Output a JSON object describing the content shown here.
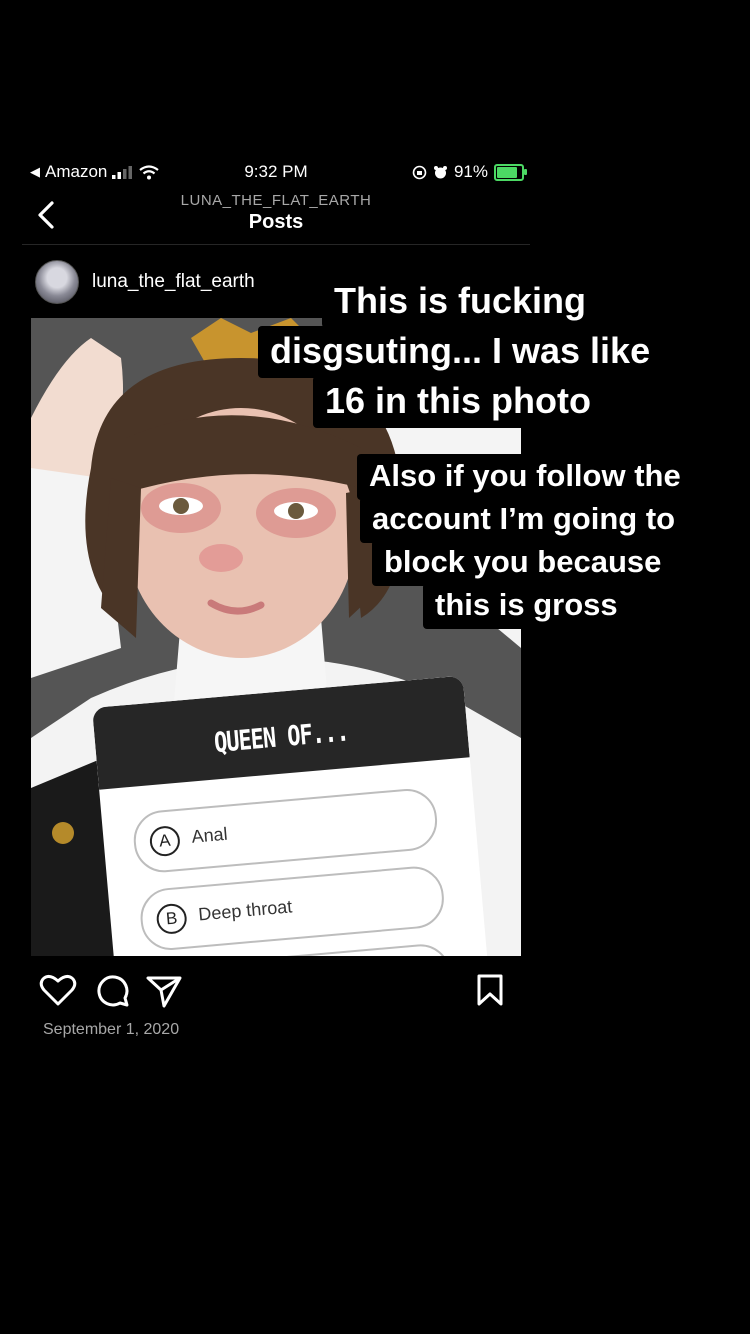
{
  "status_bar": {
    "carrier": "Amazon",
    "time": "9:32 PM",
    "battery": "91%",
    "battery_level": 0.91
  },
  "header": {
    "username": "LUNA_THE_FLAT_EARTH",
    "title": "Posts"
  },
  "post": {
    "username": "luna_the_flat_earth",
    "date": "September 1, 2020",
    "poll": {
      "title": "QUEEN OF...",
      "options": [
        {
          "letter": "A",
          "label": "Anal"
        },
        {
          "letter": "B",
          "label": "Deep throat"
        }
      ]
    }
  },
  "overlay": {
    "caption1": [
      "This is fucking",
      "disgsuting... I was like",
      "16 in this photo"
    ],
    "caption2": [
      "Also if you follow the",
      "account I’m going to",
      "block you because",
      "this is gross"
    ]
  },
  "colors": {
    "background": "#000000",
    "battery": "#4cd964",
    "muted_text": "#a8a8a8"
  },
  "icons": [
    "back-arrow-icon",
    "signal-icon",
    "wifi-icon",
    "rotation-lock-icon",
    "alarm-icon",
    "battery-icon",
    "heart-icon",
    "comment-icon",
    "share-icon",
    "bookmark-icon"
  ]
}
